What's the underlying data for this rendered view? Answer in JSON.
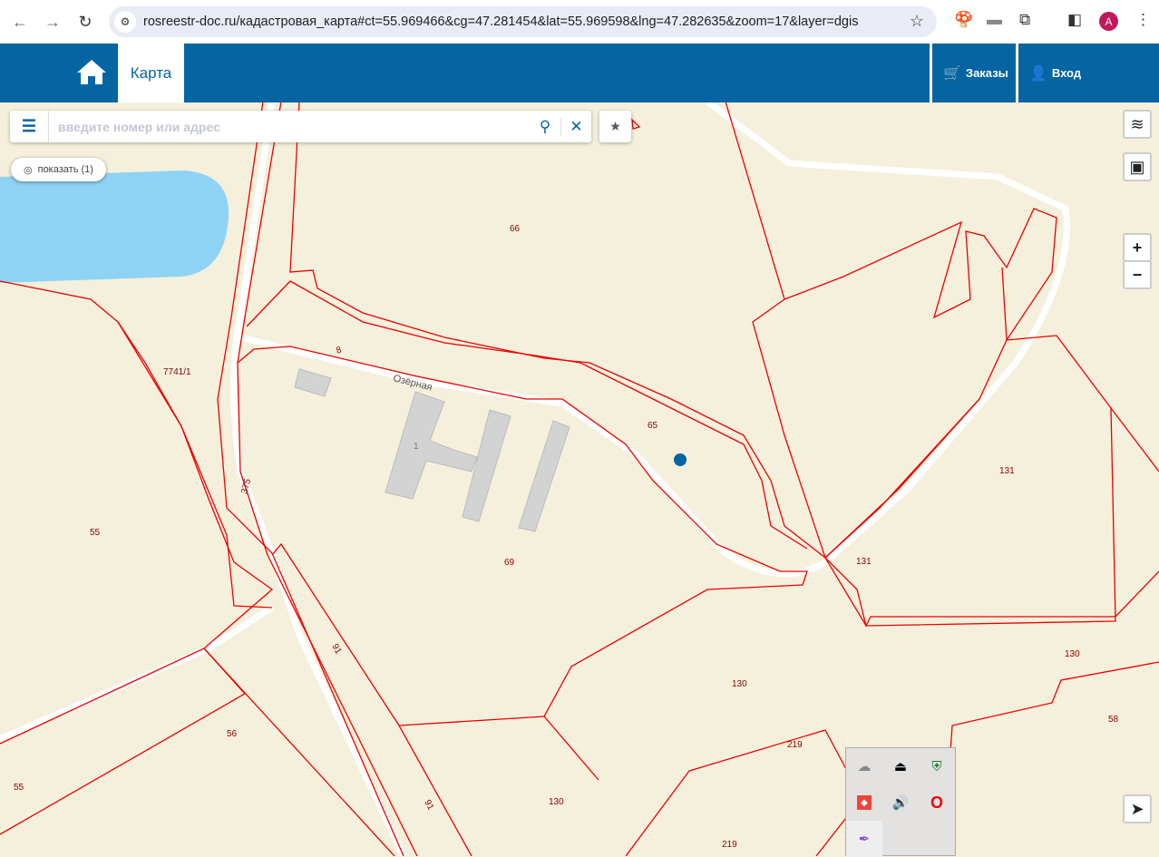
{
  "browser": {
    "url": "rosreestr-doc.ru/кадастровая_карта#ct=55.969466&cg=47.281454&lat=55.969598&lng=47.282635&zoom=17&layer=dgis",
    "avatar_letter": "A"
  },
  "header": {
    "tab_map": "Карта",
    "orders": "Заказы",
    "login": "Вход",
    "brand_color": "#0564a2"
  },
  "search": {
    "placeholder": "введите номер или адрес",
    "value": ""
  },
  "show_button": "показать (1)",
  "map": {
    "street": "Озёрная",
    "building_label": "1",
    "parcels": [
      "66",
      "7741/1",
      "65",
      "375",
      "55",
      "69",
      "131",
      "131",
      "130",
      "130",
      "58",
      "219",
      "219",
      "56",
      "55",
      "130",
      "91",
      "91",
      "8"
    ]
  },
  "tray_icons": [
    "onedrive-error-icon",
    "usb-eject-icon",
    "security-shield-icon",
    "anydesk-icon",
    "volume-icon",
    "opera-icon",
    "feather-icon"
  ]
}
